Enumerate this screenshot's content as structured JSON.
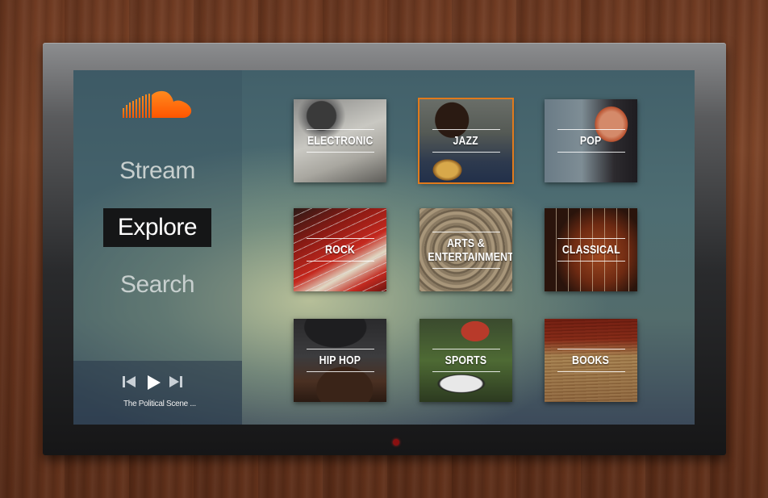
{
  "app": {
    "logo": "soundcloud-cloud-logo",
    "accent": "#ff6a00"
  },
  "nav": {
    "items": [
      {
        "label": "Stream",
        "active": false
      },
      {
        "label": "Explore",
        "active": true
      },
      {
        "label": "Search",
        "active": false
      }
    ]
  },
  "player": {
    "prev_icon": "skip-back-icon",
    "play_icon": "play-icon",
    "next_icon": "skip-forward-icon",
    "track_title": "The Political Scene ..."
  },
  "genres": [
    {
      "label": "ELECTRONIC",
      "selected": false
    },
    {
      "label": "JAZZ",
      "selected": true
    },
    {
      "label": "POP",
      "selected": false
    },
    {
      "label": "ROCK",
      "selected": false
    },
    {
      "label": "ARTS & ENTERTAINMENT",
      "selected": false
    },
    {
      "label": "CLASSICAL",
      "selected": false
    },
    {
      "label": "HIP HOP",
      "selected": false
    },
    {
      "label": "SPORTS",
      "selected": false
    },
    {
      "label": "BOOKS",
      "selected": false
    }
  ],
  "colors": {
    "selection_outline": "#e07a1c",
    "active_nav_bg": "#151617"
  }
}
